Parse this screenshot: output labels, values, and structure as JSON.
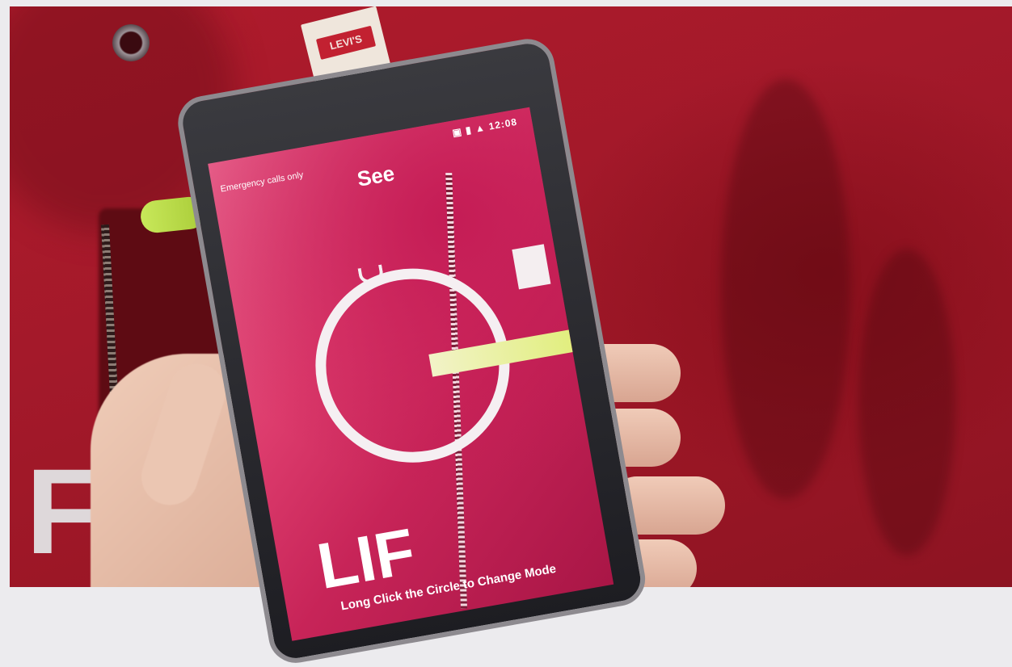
{
  "background_tag": "LEVI'S",
  "shirt_text": "F",
  "phone": {
    "status_left": "Emergency calls only",
    "status_right": "▣ ▮ ▲ 12:08",
    "app_title": "See",
    "screen_text": "LIF",
    "hint": "Long Click the Circle to Change Mode"
  },
  "colors": {
    "shirt": "#a3192a",
    "zipper_pull": "#c8e85a",
    "screen_tint": "#dd3c6d"
  }
}
